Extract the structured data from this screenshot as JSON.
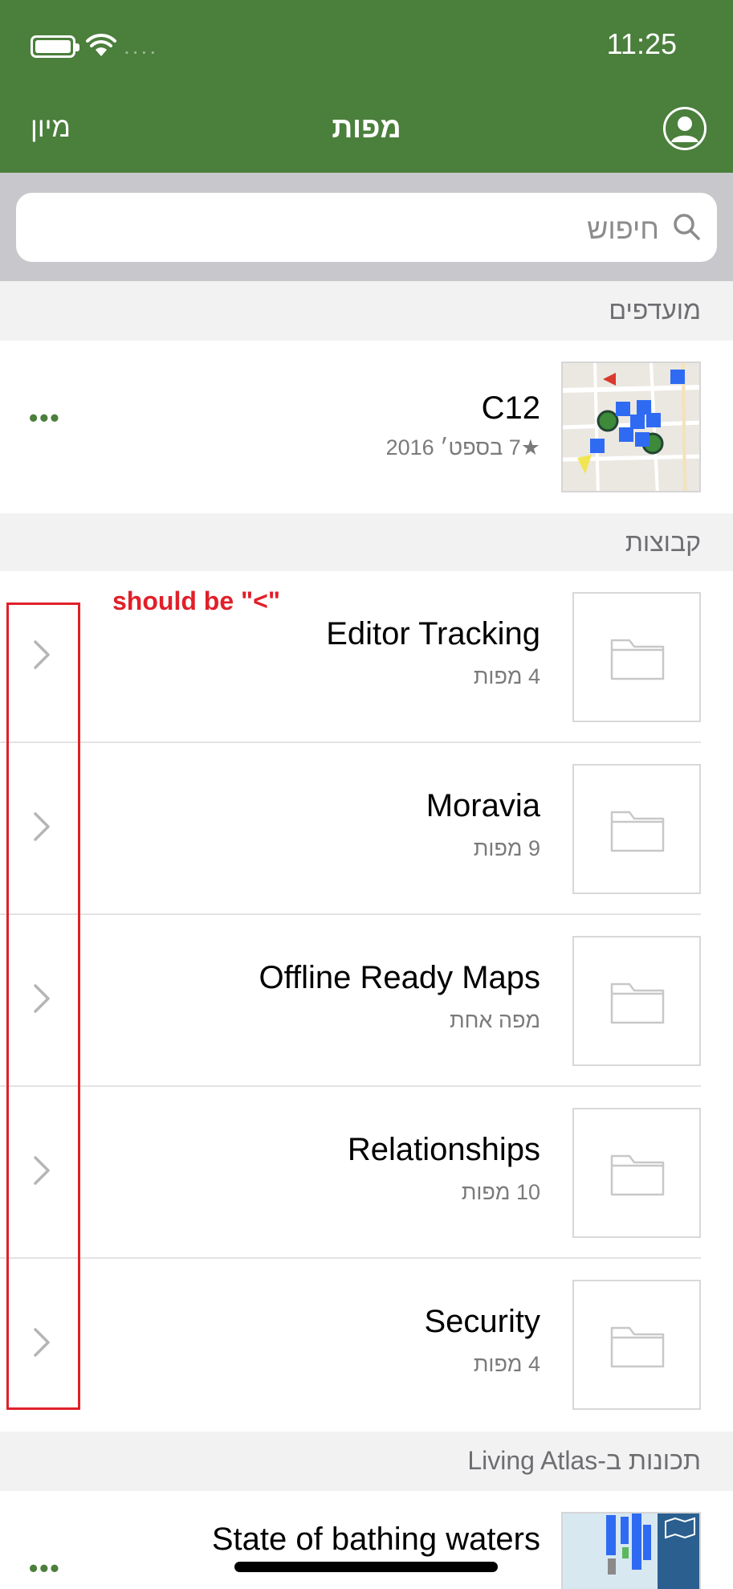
{
  "status_bar": {
    "time": "11:25"
  },
  "nav": {
    "title": "מפות",
    "sort_label": "מיון"
  },
  "search": {
    "placeholder": "חיפוש"
  },
  "favorites": {
    "header": "מועדפים",
    "items": [
      {
        "title": "C12",
        "subtitle": "★7 בספט׳ 2016"
      }
    ]
  },
  "groups": {
    "header": "קבוצות",
    "items": [
      {
        "title": "Editor Tracking",
        "subtitle": "4 מפות"
      },
      {
        "title": "Moravia",
        "subtitle": "9 מפות"
      },
      {
        "title": "Offline Ready Maps",
        "subtitle": "מפה אחת"
      },
      {
        "title": "Relationships",
        "subtitle": "10 מפות"
      },
      {
        "title": "Security",
        "subtitle": "4 מפות"
      }
    ]
  },
  "living_atlas": {
    "header": "תכונות ב-Living Atlas",
    "items": [
      {
        "title": "State of bathing waters"
      }
    ]
  },
  "annotation": {
    "text": "should be \"<\""
  },
  "colors": {
    "nav_green": "#4b7f3c",
    "annotation_red": "#e0202a",
    "map_blue": "#2f6bf2"
  }
}
